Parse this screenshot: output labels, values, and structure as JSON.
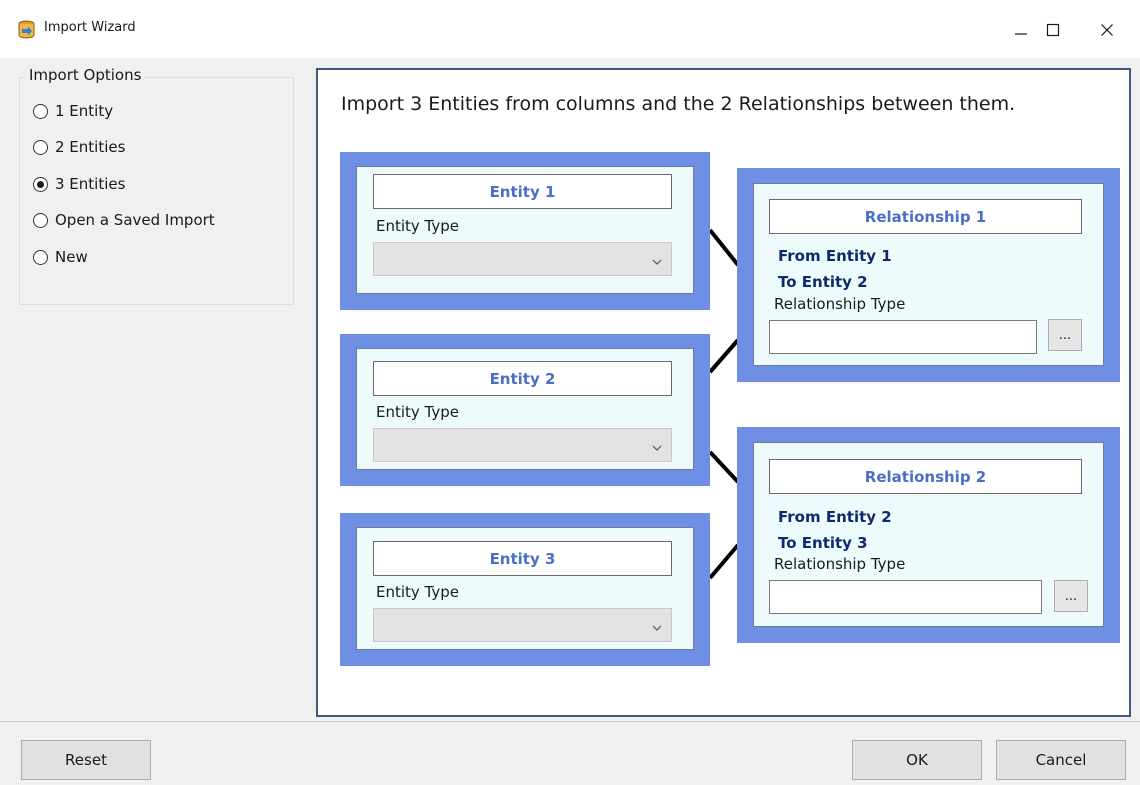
{
  "window": {
    "title": "Import Wizard",
    "icon": "database-import-icon",
    "controls": [
      "minimize-icon",
      "maximize-icon",
      "close-icon"
    ]
  },
  "import_options": {
    "legend": "Import Options",
    "options": [
      {
        "label": "1 Entity",
        "checked": false
      },
      {
        "label": "2 Entities",
        "checked": false
      },
      {
        "label": "3 Entities",
        "checked": true
      },
      {
        "label": "Open a Saved Import",
        "checked": false
      },
      {
        "label": "New",
        "checked": false
      }
    ]
  },
  "main": {
    "headline": "Import 3 Entities from columns and the 2 Relationships between them.",
    "entities": [
      {
        "title": "Entity 1",
        "type_label": "Entity Type",
        "type_value": ""
      },
      {
        "title": "Entity 2",
        "type_label": "Entity Type",
        "type_value": ""
      },
      {
        "title": "Entity 3",
        "type_label": "Entity Type",
        "type_value": ""
      }
    ],
    "relationships": [
      {
        "title": "Relationship 1",
        "from": "From Entity 1",
        "to": "To Entity 2",
        "type_label": "Relationship Type",
        "type_value": "",
        "browse_label": "..."
      },
      {
        "title": "Relationship 2",
        "from": "From Entity 2",
        "to": "To Entity 3",
        "type_label": "Relationship Type",
        "type_value": "",
        "browse_label": "..."
      }
    ]
  },
  "footer": {
    "reset_label": "Reset",
    "ok_label": "OK",
    "cancel_label": "Cancel"
  },
  "colors": {
    "panel_border": "#3d5a80",
    "box_blue": "#6e8fe4",
    "box_fill": "#eefbfd",
    "title_blue": "#4a6fc6",
    "relation_text": "#0f2a6b"
  }
}
